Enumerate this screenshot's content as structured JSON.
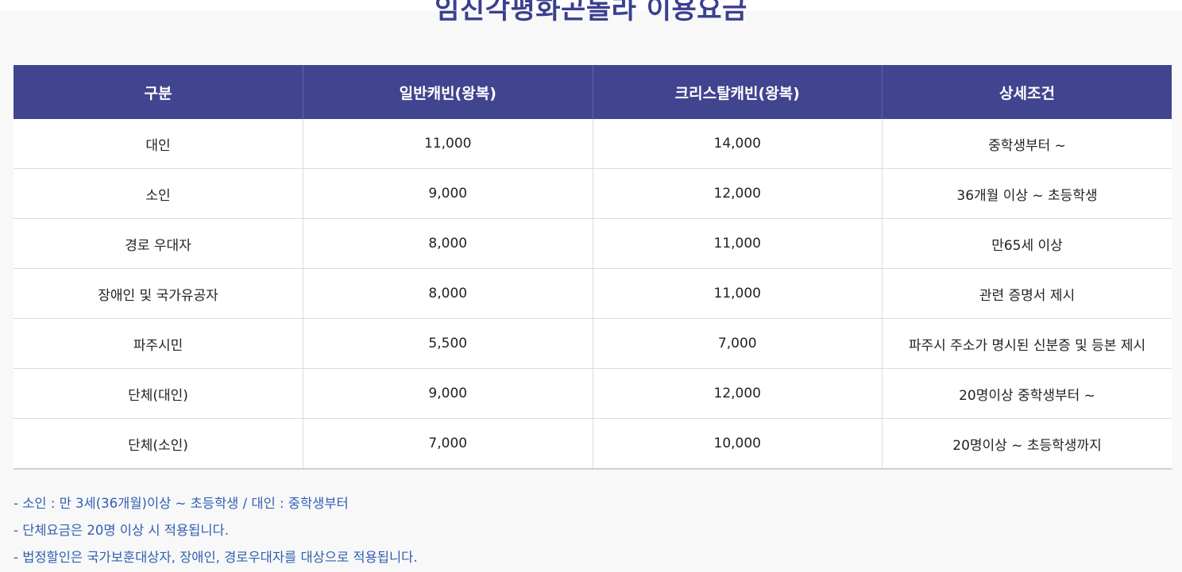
{
  "title": "임진각평화곤돌라 이용요금",
  "table": {
    "headers": [
      "구분",
      "일반캐빈(왕복)",
      "크리스탈캐빈(왕복)",
      "상세조건"
    ],
    "rows": [
      [
        "대인",
        "11,000",
        "14,000",
        "중학생부터 ~"
      ],
      [
        "소인",
        "9,000",
        "12,000",
        "36개월 이상 ~ 초등학생"
      ],
      [
        "경로 우대자",
        "8,000",
        "11,000",
        "만65세 이상"
      ],
      [
        "장애인 및 국가유공자",
        "8,000",
        "11,000",
        "관련 증명서 제시"
      ],
      [
        "파주시민",
        "5,500",
        "7,000",
        "파주시 주소가 명시된 신분증 및 등본 제시"
      ],
      [
        "단체(대인)",
        "9,000",
        "12,000",
        "20명이상 중학생부터 ~"
      ],
      [
        "단체(소인)",
        "7,000",
        "10,000",
        "20명이상 ~ 초등학생까지"
      ]
    ]
  },
  "notes": [
    "- 소인 : 만 3세(36개월)이상 ~ 초등학생 / 대인 : 중학생부터",
    "- 단체요금은 20명 이상 시 적용됩니다.",
    "- 법정할인은 국가보훈대상자, 장애인, 경로우대자를 대상으로 적용됩니다."
  ],
  "colors": {
    "title": "#3a3f8f",
    "header_bg": "#41448f",
    "notes_text": "#2f5fb0"
  }
}
